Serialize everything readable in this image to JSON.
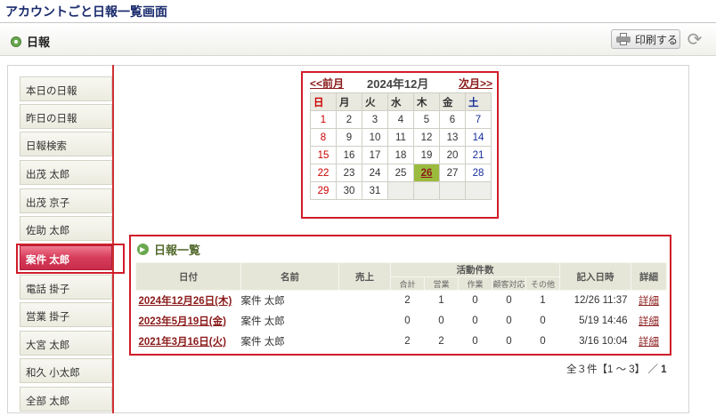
{
  "page": {
    "title": "アカウントごと日報一覧画面"
  },
  "header": {
    "title": "日報",
    "print_label": "印刷する"
  },
  "sidebar": {
    "items": [
      {
        "label": "本日の日報"
      },
      {
        "label": "昨日の日報"
      },
      {
        "label": "日報検索"
      },
      {
        "label": "出茂 太郎"
      },
      {
        "label": "出茂 京子"
      },
      {
        "label": "佐助 太郎"
      },
      {
        "label": "案件 太郎",
        "active": true
      },
      {
        "label": "電話 掛子"
      },
      {
        "label": "営業 掛子"
      },
      {
        "label": "大宮 太郎"
      },
      {
        "label": "和久 小太郎"
      },
      {
        "label": "全部 太郎"
      }
    ]
  },
  "calendar": {
    "prev_label": "<<前月",
    "title": "2024年12月",
    "next_label": "次月>>",
    "weekdays": [
      "日",
      "月",
      "火",
      "水",
      "木",
      "金",
      "土"
    ],
    "weeks": [
      [
        "1",
        "2",
        "3",
        "4",
        "5",
        "6",
        "7"
      ],
      [
        "8",
        "9",
        "10",
        "11",
        "12",
        "13",
        "14"
      ],
      [
        "15",
        "16",
        "17",
        "18",
        "19",
        "20",
        "21"
      ],
      [
        "22",
        "23",
        "24",
        "25",
        "26",
        "27",
        "28"
      ],
      [
        "29",
        "30",
        "31",
        "",
        "",
        "",
        ""
      ]
    ],
    "today": "26"
  },
  "report_list": {
    "title": "日報一覧",
    "headers": {
      "date": "日付",
      "name": "名前",
      "sales": "売上",
      "activity": "活動件数",
      "written_at": "記入日時",
      "detail": "詳細"
    },
    "activity_subheaders": [
      "合計",
      "営業",
      "作業",
      "顧客対応",
      "その他"
    ],
    "rows": [
      {
        "date": "2024年12月26日(木)",
        "name": "案件 太郎",
        "sales": "",
        "total": "2",
        "eigyo": "1",
        "sagyo": "0",
        "kokyaku": "0",
        "other": "1",
        "written_at": "12/26 11:37",
        "detail": "詳細"
      },
      {
        "date": "2023年5月19日(金)",
        "name": "案件 太郎",
        "sales": "",
        "total": "0",
        "eigyo": "0",
        "sagyo": "0",
        "kokyaku": "0",
        "other": "0",
        "written_at": "5/19 14:46",
        "detail": "詳細"
      },
      {
        "date": "2021年3月16日(火)",
        "name": "案件 太郎",
        "sales": "",
        "total": "2",
        "eigyo": "2",
        "sagyo": "0",
        "kokyaku": "0",
        "other": "0",
        "written_at": "3/16 10:04",
        "detail": "詳細"
      }
    ]
  },
  "pagination": {
    "summary": "全３件【1 ～ 3】",
    "slash": "／",
    "page": "1"
  }
}
